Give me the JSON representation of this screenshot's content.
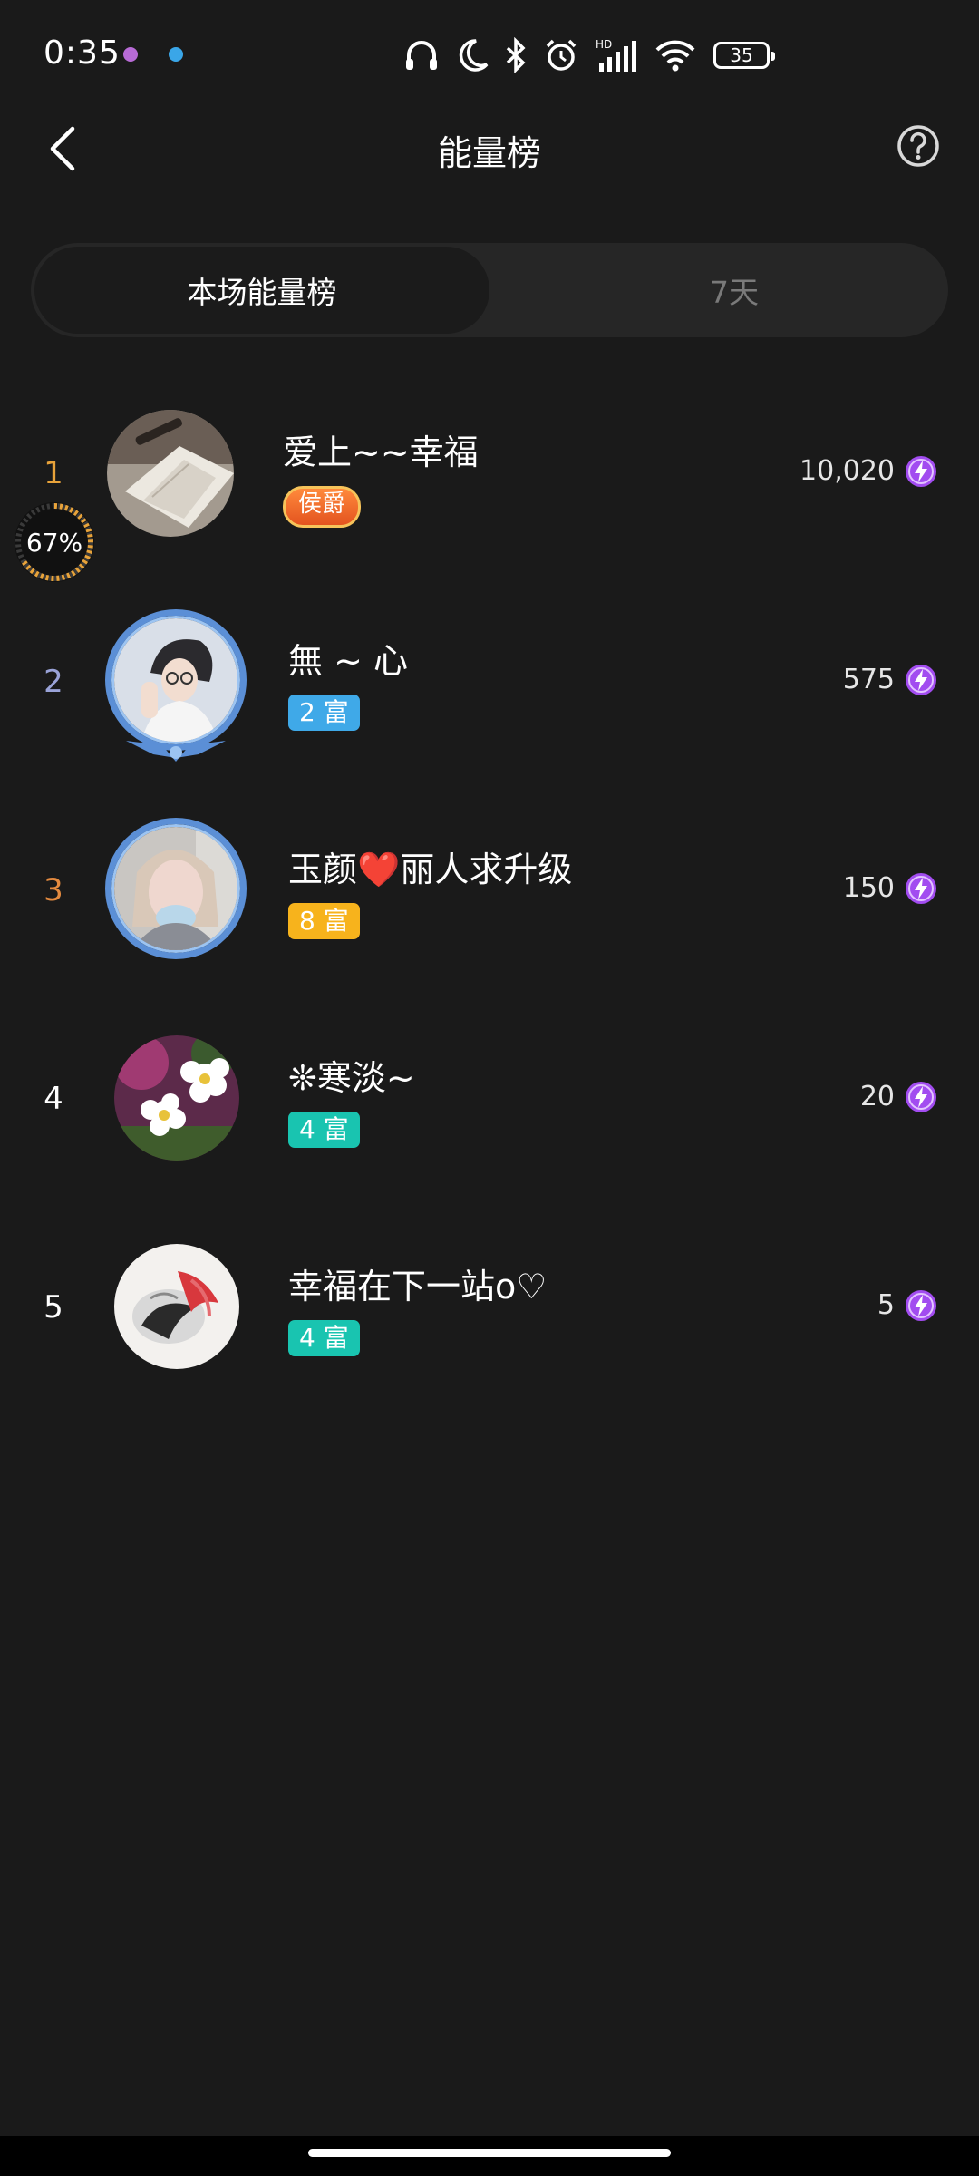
{
  "status_bar": {
    "time": "0:35",
    "battery": "35"
  },
  "header": {
    "title": "能量榜"
  },
  "tabs": [
    {
      "label": "本场能量榜",
      "active": true
    },
    {
      "label": "7天",
      "active": false
    }
  ],
  "entries": [
    {
      "rank": "1",
      "rank_color": "#e8a33a",
      "name": "爱上~~幸福",
      "badge": "侯爵",
      "badge_type": "duke",
      "score": "10,020",
      "progress": "67%",
      "avatar": "book-photo"
    },
    {
      "rank": "2",
      "rank_color": "#9aa3d8",
      "name": "無 ~ 心",
      "badge": "2 富",
      "badge_color": "#3fa9e8",
      "score": "575",
      "avatar": "illustrated-man"
    },
    {
      "rank": "3",
      "rank_color": "#e48a3f",
      "name": "玉颜❤️丽人求升级",
      "badge": "8 富",
      "badge_color": "#f7b31c",
      "score": "150",
      "avatar": "woman-selfie"
    },
    {
      "rank": "4",
      "rank_color": "#ffffff",
      "name": "❊寒淡~",
      "badge": "4 富",
      "badge_color": "#19c4b0",
      "score": "20",
      "avatar": "white-flowers"
    },
    {
      "rank": "5",
      "rank_color": "#ffffff",
      "name": "幸福在下一站o♡",
      "badge": "4 富",
      "badge_color": "#19c4b0",
      "score": "5",
      "avatar": "koi-painting"
    }
  ],
  "colors": {
    "background": "#1a1a1a",
    "energy_icon": "#a24cf0"
  }
}
